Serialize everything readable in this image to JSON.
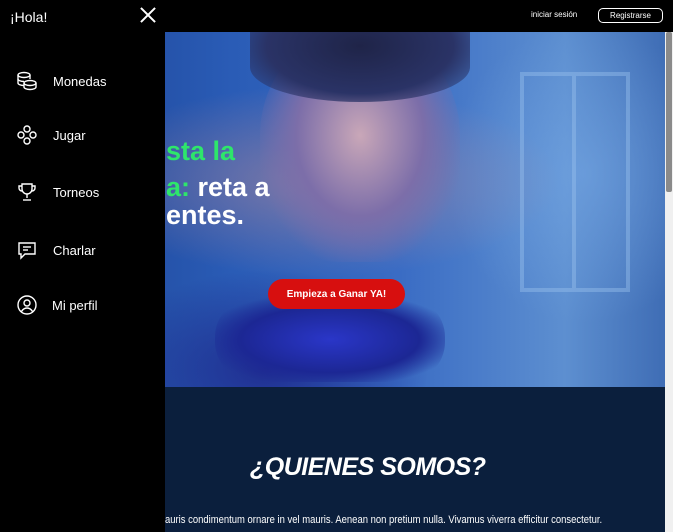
{
  "header": {
    "login_label": "iniciar sesión",
    "register_label": "Registrarse"
  },
  "sidebar": {
    "greeting": "¡Hola!",
    "items": [
      {
        "label": "Monedas",
        "icon": "coins-icon"
      },
      {
        "label": "Jugar",
        "icon": "gamepad-icon"
      },
      {
        "label": "Torneos",
        "icon": "trophy-icon"
      },
      {
        "label": "Charlar",
        "icon": "chat-icon"
      },
      {
        "label": "Mi perfil",
        "icon": "user-profile-icon"
      }
    ]
  },
  "hero": {
    "line1": "sta la",
    "line2_accent": "a:",
    "line2_rest": " reta a",
    "line3": "entes.",
    "cta_label": "Empieza a Ganar YA!"
  },
  "about": {
    "title": "¿QUIENES SOMOS?",
    "text": "auris condimentum ornare in vel mauris. Aenean non pretium nulla. Vivamus viverra efficitur consectetur."
  },
  "colors": {
    "accent_green": "#2ee66b",
    "cta_red": "#d70f0f",
    "section_navy": "#0b1f3d"
  }
}
